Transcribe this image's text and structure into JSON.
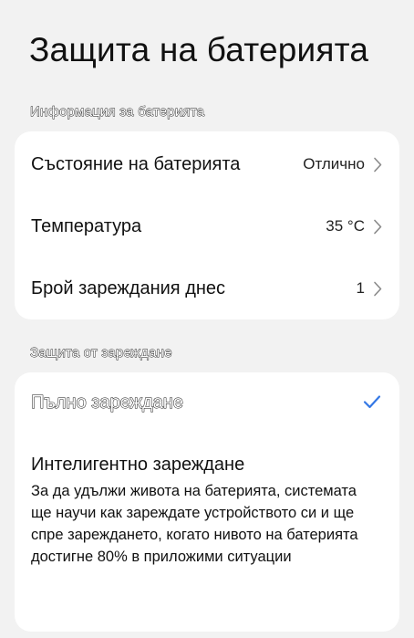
{
  "page": {
    "title": "Защита на батерията"
  },
  "battery_info": {
    "section_title": "Информация за батерията",
    "rows": [
      {
        "label": "Състояние на батерията",
        "value": "Отлично"
      },
      {
        "label": "Температура",
        "value": "35 °C"
      },
      {
        "label": "Брой зареждания днес",
        "value": "1"
      }
    ]
  },
  "charge_protection": {
    "section_title": "Защита от зареждане",
    "full_charge": {
      "label": "Пълно зареждане",
      "selected": true
    },
    "smart_charge": {
      "title": "Интелигентно зареждане",
      "description": "За да удължи живота на батерията, системата ще научи как зареждате устройството си и ще спре зареждането, когато нивото на батерията достигне 80% в приложими ситуации"
    }
  },
  "colors": {
    "accent": "#3478e5",
    "chevron": "#8a8a8a",
    "background": "#f2f2f2",
    "card": "#ffffff"
  },
  "icons": {
    "row_chevron": "chevron-right-icon",
    "selected": "check-icon"
  }
}
